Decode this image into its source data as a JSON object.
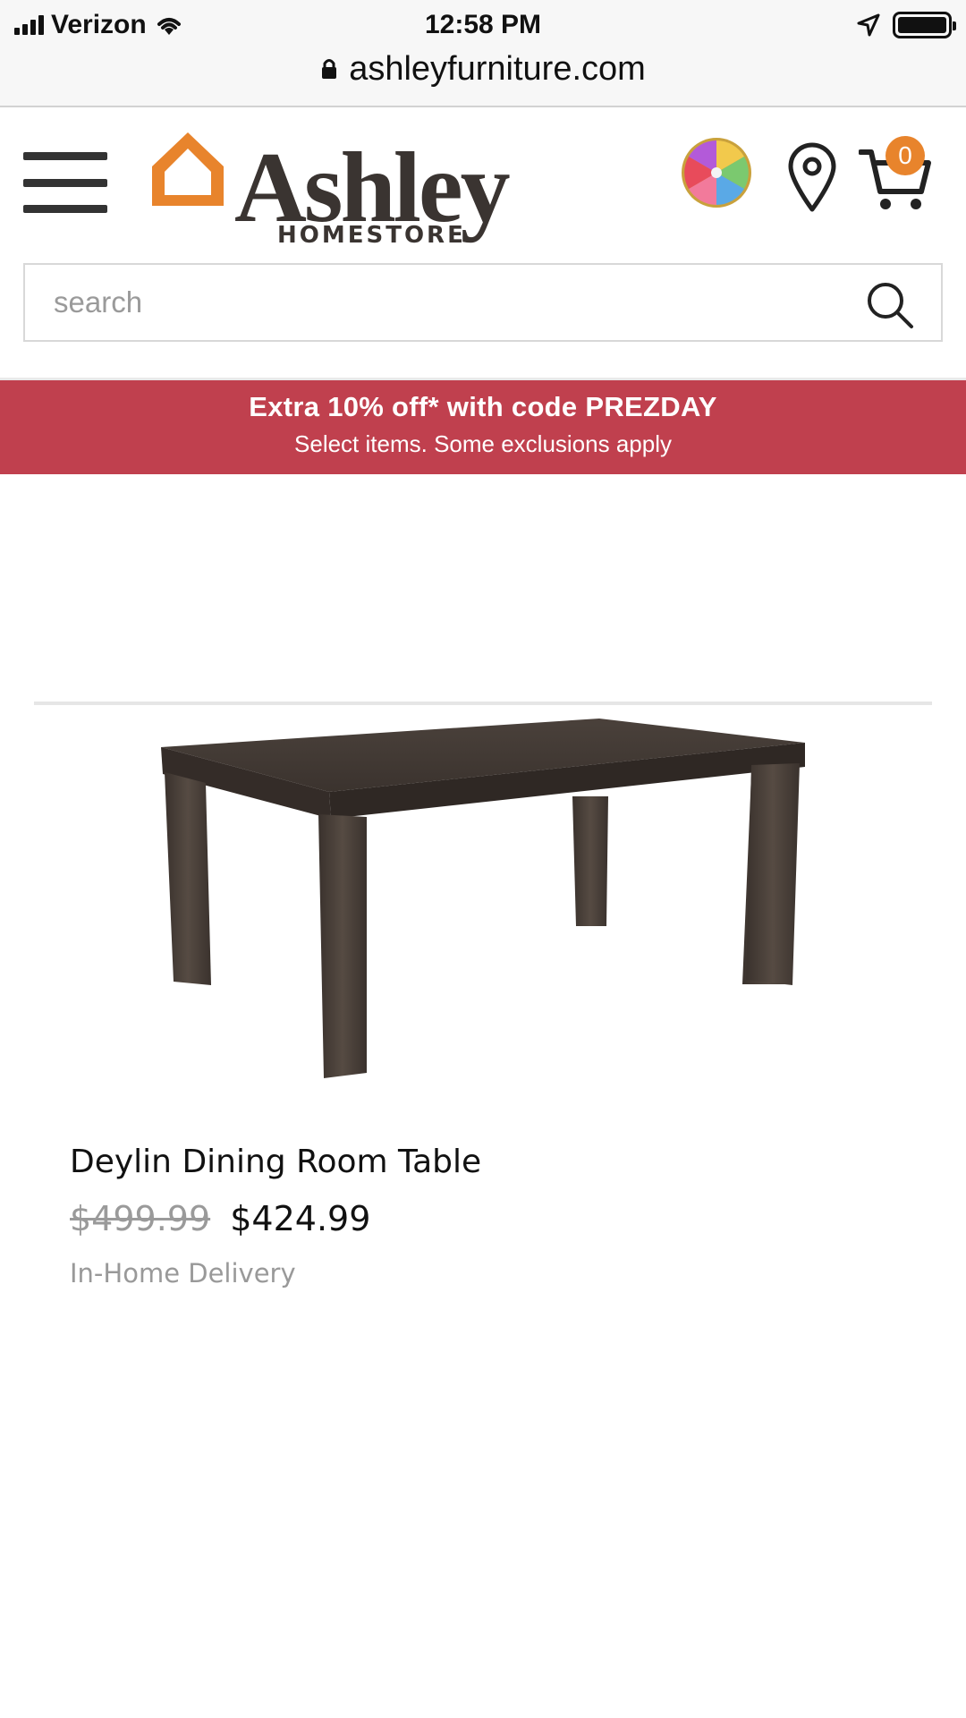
{
  "status_bar": {
    "carrier": "Verizon",
    "time": "12:58 PM"
  },
  "browser": {
    "url": "ashleyfurniture.com"
  },
  "header": {
    "logo_word": "Ashley",
    "logo_sub": "HOMESTORE",
    "cart_count": "0",
    "icons": [
      "menu-icon",
      "spin-wheel-icon",
      "location-pin-icon",
      "cart-icon"
    ]
  },
  "search": {
    "placeholder": "search"
  },
  "promo": {
    "title": "Extra 10% off* with code PREZDAY",
    "subtitle": "Select items. Some exclusions apply",
    "color": "#c0404e"
  },
  "product": {
    "name": "Deylin Dining Room Table",
    "old_price": "$499.99",
    "price": "$424.99",
    "delivery": "In-Home Delivery"
  },
  "colors": {
    "brand_orange": "#e8842c",
    "logo_text": "#3a3431"
  }
}
